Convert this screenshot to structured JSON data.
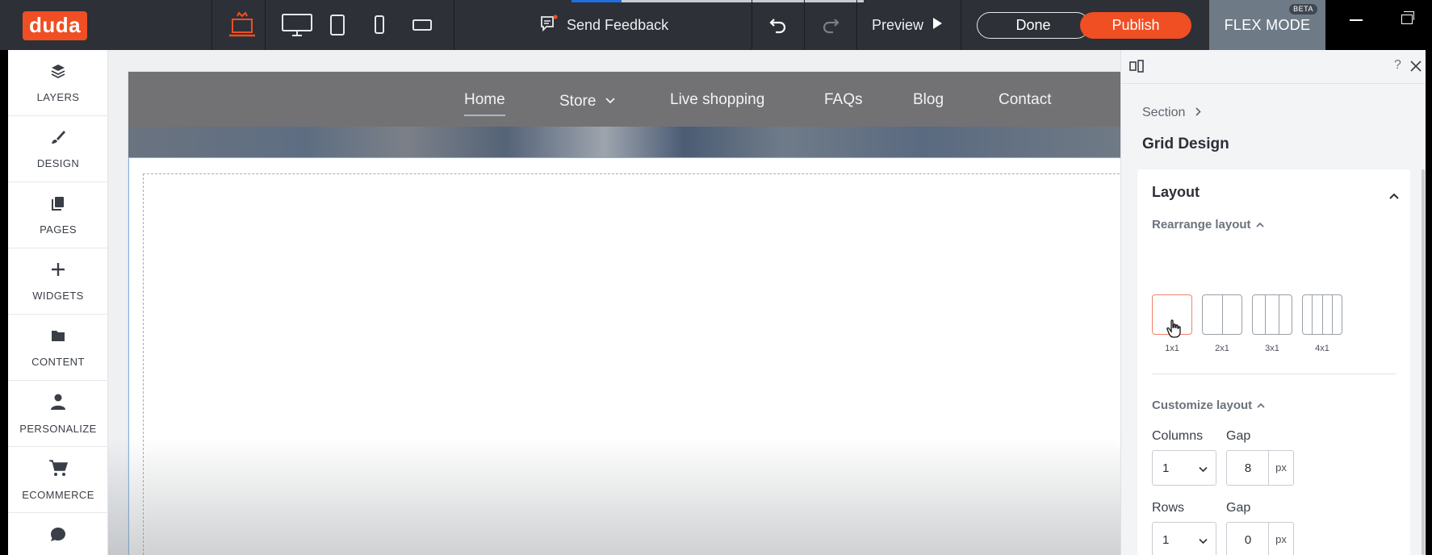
{
  "app": {
    "logo": "duda",
    "feedback_label": "Send Feedback",
    "preview_label": "Preview",
    "done_label": "Done",
    "publish_label": "Publish",
    "flex_mode_label": "FLEX MODE",
    "beta_label": "BETA",
    "brand_color": "#f04e23",
    "devices": [
      "laptop-icon",
      "desktop-icon",
      "tablet-icon",
      "mobile-icon",
      "tablet-landscape-icon"
    ],
    "load_progress": 0.17
  },
  "sidebar": {
    "items": [
      {
        "label": "LAYERS",
        "icon": "layers-icon"
      },
      {
        "label": "DESIGN",
        "icon": "brush-icon"
      },
      {
        "label": "PAGES",
        "icon": "pages-icon"
      },
      {
        "label": "WIDGETS",
        "icon": "plus-icon"
      },
      {
        "label": "CONTENT",
        "icon": "folder-icon"
      },
      {
        "label": "PERSONALIZE",
        "icon": "person-icon"
      },
      {
        "label": "ECOMMERCE",
        "icon": "cart-icon"
      },
      {
        "label": "",
        "icon": "chat-icon"
      }
    ]
  },
  "site": {
    "nav": [
      "Home",
      "Store",
      "Live shopping",
      "FAQs",
      "Blog",
      "Contact"
    ],
    "active_nav": "Home"
  },
  "panel": {
    "breadcrumb": "Section",
    "title": "Grid Design",
    "section_title": "Layout",
    "rearrange_title": "Rearrange layout",
    "layout_options": [
      "1x1",
      "2x1",
      "3x1",
      "4x1"
    ],
    "selected_layout": "1x1",
    "customize_title": "Customize layout",
    "columns_label": "Columns",
    "columns_value": "1",
    "col_gap_label": "Gap",
    "col_gap_value": "8",
    "rows_label": "Rows",
    "rows_value": "1",
    "row_gap_label": "Gap",
    "row_gap_value": "0",
    "unit": "px"
  }
}
